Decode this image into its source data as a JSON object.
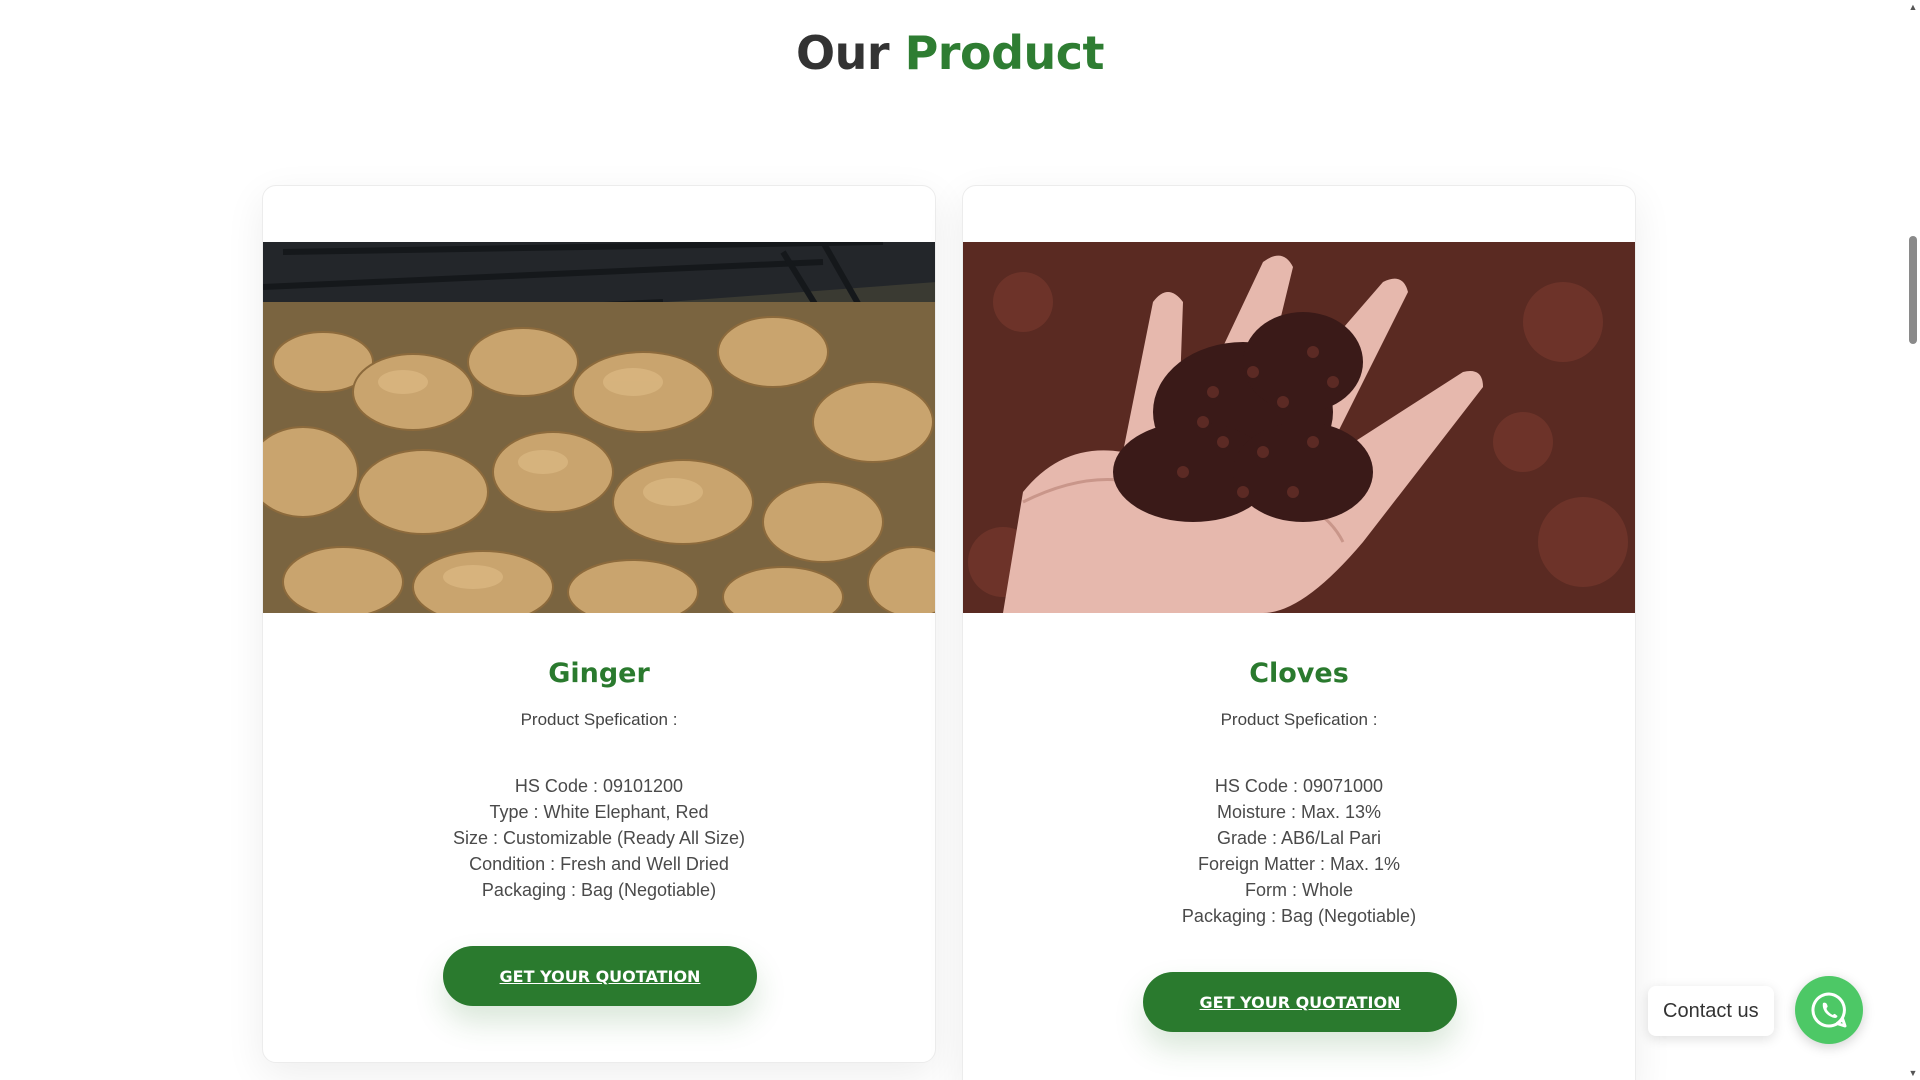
{
  "section": {
    "title_part1": "Our",
    "title_part2": "Product"
  },
  "products": [
    {
      "name": "Ginger",
      "spec_heading": "Product Spefication :",
      "specs": [
        "HS Code : 09101200",
        "Type : White Elephant, Red",
        "Size : Customizable (Ready All Size)",
        "Condition : Fresh and Well Dried",
        "Packaging : Bag (Negotiable)"
      ],
      "button_label": "GET YOUR QUOTATION"
    },
    {
      "name": "Cloves",
      "spec_heading": "Product Spefication :",
      "specs": [
        "HS Code : 09071000",
        "Moisture : Max. 13%",
        "Grade : AB6/Lal Pari",
        "Foreign Matter : Max. 1%",
        "Form : Whole",
        "Packaging : Bag (Negotiable)"
      ],
      "button_label": "GET YOUR QUOTATION"
    }
  ],
  "contact": {
    "label": "Contact us",
    "icon": "whatsapp-icon"
  },
  "colors": {
    "accent": "#2a7a2e",
    "title_dark": "#333333",
    "whatsapp": "#4dc866"
  }
}
